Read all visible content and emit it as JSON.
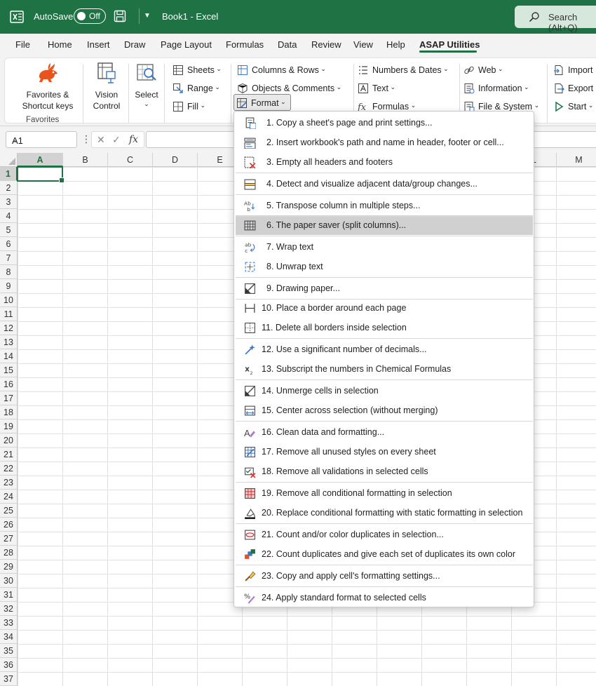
{
  "titlebar": {
    "autosave_label": "AutoSave",
    "toggle_label": "Off",
    "title": "Book1  -  Excel",
    "search_placeholder": "Search (Alt+Q)"
  },
  "tabs": [
    "File",
    "Home",
    "Insert",
    "Draw",
    "Page Layout",
    "Formulas",
    "Data",
    "Review",
    "View",
    "Help",
    "ASAP Utilities"
  ],
  "ribbon": {
    "favorites_label": "Favorites &\nShortcut keys",
    "favorites_group": "Favorites",
    "vision_label": "Vision\nControl",
    "select_label": "Select",
    "col1": [
      "Sheets",
      "Range",
      "Fill"
    ],
    "col2": [
      "Columns & Rows",
      "Objects & Comments",
      "Format"
    ],
    "col3": [
      "Numbers & Dates",
      "Text",
      "Formulas"
    ],
    "col4": [
      "Web",
      "Information",
      "File & System"
    ],
    "col5": [
      "Import",
      "Export",
      "Start"
    ]
  },
  "formula_bar": {
    "name_box": "A1",
    "fx": "fx",
    "formula": ""
  },
  "grid": {
    "columns": [
      "A",
      "B",
      "C",
      "D",
      "E",
      "F",
      "G",
      "H",
      "I",
      "J",
      "K",
      "L",
      "M"
    ],
    "rows": [
      "1",
      "2",
      "3",
      "4",
      "5",
      "6",
      "7",
      "8",
      "9",
      "10",
      "11",
      "12",
      "13",
      "14",
      "15",
      "16",
      "17",
      "18",
      "19",
      "20",
      "21",
      "22",
      "23",
      "24",
      "25",
      "26",
      "27",
      "28",
      "29",
      "30",
      "31",
      "32",
      "33",
      "34",
      "35",
      "36",
      "37"
    ],
    "active_cell": "A1"
  },
  "menu": {
    "items": [
      "1. Copy a sheet's page and print settings...",
      "2. Insert workbook's path and name in header, footer or cell...",
      "3. Empty all headers and footers",
      "4. Detect and visualize adjacent data/group changes...",
      "5. Transpose column in multiple steps...",
      "6. The paper saver (split columns)...",
      "7. Wrap text",
      "8. Unwrap text",
      "9. Drawing paper...",
      "10. Place a border around each page",
      "11. Delete all borders inside selection",
      "12. Use a significant number of decimals...",
      "13. Subscript the numbers in Chemical Formulas",
      "14. Unmerge cells in selection",
      "15. Center across selection (without merging)",
      "16. Clean data and formatting...",
      "17. Remove all unused styles on every sheet",
      "18. Remove all validations in selected cells",
      "19. Remove all conditional formatting in selection",
      "20. Replace conditional formatting with static formatting in selection",
      "21. Count and/or color duplicates in selection...",
      "22. Count duplicates and give each set of duplicates its own color",
      "23. Copy and apply cell's formatting settings...",
      "24. Apply standard format to selected cells"
    ],
    "highlighted_index": 5
  },
  "colors": {
    "excel_green": "#1f7244",
    "menu_highlight": "#d0d0d0"
  }
}
